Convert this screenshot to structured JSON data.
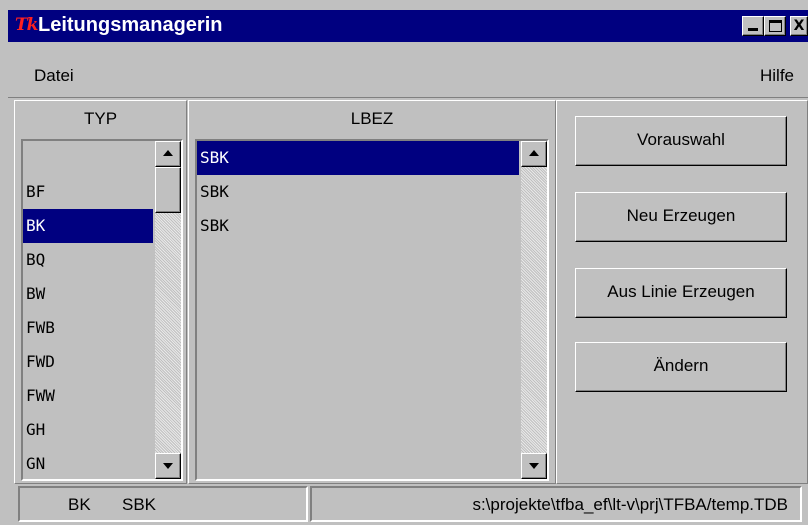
{
  "window": {
    "title": "Leitungsmanagerin",
    "logo_text": "Tk",
    "title_bar_color": "#000080",
    "close_label": "X"
  },
  "menu": {
    "datei": "Datei",
    "hilfe": "Hilfe"
  },
  "typ_column": {
    "header": "TYP",
    "items": [
      "",
      "BF",
      "BK",
      "BQ",
      "BW",
      "FWB",
      "FWD",
      "FWW",
      "GH",
      "GN"
    ],
    "selected": "BK"
  },
  "lbez_column": {
    "header": "LBEZ",
    "items": [
      "SBK",
      "SBK",
      "SBK"
    ],
    "selected_index": 0
  },
  "buttons": {
    "vorauswahl": "Vorauswahl",
    "neu_erzeugen": "Neu Erzeugen",
    "aus_linie_erzeugen": "Aus Linie Erzeugen",
    "aendern": "Ändern"
  },
  "status": {
    "typ": "BK",
    "lbez": "SBK",
    "path": "s:\\projekte\\tfba_ef\\lt-v\\prj\\TFBA/temp.TDB"
  },
  "colors": {
    "selection_background": "#000080",
    "window_background": "#c0c0c0"
  }
}
